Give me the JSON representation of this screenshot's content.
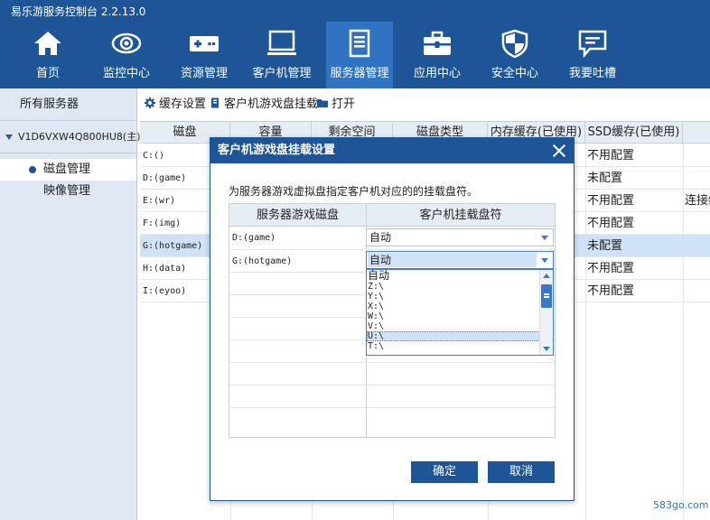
{
  "app": {
    "title": "易乐游服务控制台 2.2.13.0"
  },
  "nav": [
    {
      "label": "首页",
      "icon": "home-icon"
    },
    {
      "label": "监控中心",
      "icon": "eye-icon"
    },
    {
      "label": "资源管理",
      "icon": "gamepad-icon"
    },
    {
      "label": "客户机管理",
      "icon": "monitor-icon"
    },
    {
      "label": "服务器管理",
      "icon": "server-icon",
      "active": true
    },
    {
      "label": "应用中心",
      "icon": "toolbox-icon"
    },
    {
      "label": "安全中心",
      "icon": "shield-icon"
    },
    {
      "label": "我要吐槽",
      "icon": "chat-icon"
    }
  ],
  "sidebar": {
    "all_servers": "所有服务器",
    "server": "V1D6VXW4Q800HU8(主)",
    "items": [
      {
        "label": "磁盘管理",
        "selected": true
      },
      {
        "label": "映像管理"
      }
    ]
  },
  "toolbar": {
    "cache_settings": "缓存设置",
    "client_mount": "客户机游戏盘挂载",
    "open": "打开"
  },
  "table": {
    "columns": [
      "磁盘",
      "容量",
      "剩余空间",
      "磁盘类型",
      "内存缓存(已使用)",
      "SSD缓存(已使用)"
    ],
    "rows": [
      {
        "disk": "C:()",
        "ssd": "不用配置",
        "extra": ""
      },
      {
        "disk": "D:(game)",
        "ssd": "未配置",
        "extra": ""
      },
      {
        "disk": "E:(wr)",
        "ssd": "不用配置",
        "extra": "连接维"
      },
      {
        "disk": "F:(img)",
        "ssd": "不用配置",
        "extra": ""
      },
      {
        "disk": "G:(hotgame)",
        "ssd": "未配置",
        "extra": "",
        "selected": true
      },
      {
        "disk": "H:(data)",
        "ssd": "不用配置",
        "extra": ""
      },
      {
        "disk": "I:(eyoo)",
        "ssd": "不用配置",
        "extra": ""
      }
    ]
  },
  "dialog": {
    "title": "客户机游戏盘挂载设置",
    "description": "为服务器游戏虚拟盘指定客户机对应的的挂载盘符。",
    "columns": [
      "服务器游戏磁盘",
      "客户机挂载盘符"
    ],
    "rows": [
      {
        "disk": "D:(game)",
        "value": "自动"
      },
      {
        "disk": "G:(hotgame)",
        "value": "自动"
      }
    ],
    "dropdown_options": [
      "自动",
      "Z:\\",
      "Y:\\",
      "X:\\",
      "W:\\",
      "V:\\",
      "U:\\",
      "T:\\"
    ],
    "dropdown_highlight": "U:\\",
    "ok": "确定",
    "cancel": "取消"
  },
  "watermark": "583go.com",
  "colors": {
    "brand": "#1d5597",
    "active_nav": "#2f73c2",
    "selection": "#cfe2f8"
  }
}
